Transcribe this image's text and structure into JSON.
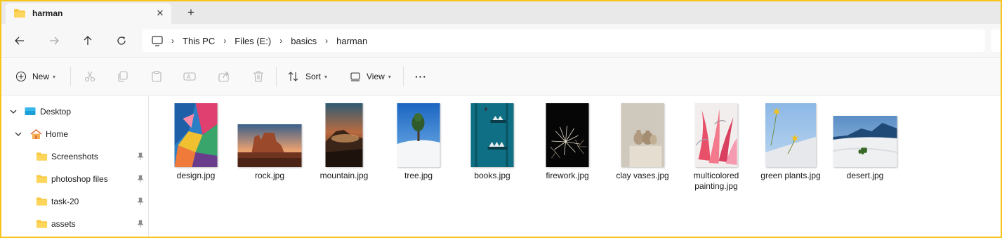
{
  "tab": {
    "title": "harman",
    "close_glyph": "✕",
    "new_tab_glyph": "+"
  },
  "nav": {
    "breadcrumbs": [
      "This PC",
      "Files (E:)",
      "basics",
      "harman"
    ]
  },
  "command_bar": {
    "new_label": "New",
    "sort_label": "Sort",
    "view_label": "View",
    "more_glyph": "···"
  },
  "sidebar": {
    "items": [
      {
        "label": "Desktop",
        "icon": "desktop-icon"
      },
      {
        "label": "Home",
        "icon": "home-icon"
      },
      {
        "label": "Screenshots",
        "icon": "folder-icon",
        "pinned": true
      },
      {
        "label": "photoshop files",
        "icon": "folder-icon",
        "pinned": true
      },
      {
        "label": "task-20",
        "icon": "folder-icon",
        "pinned": true
      },
      {
        "label": "assets",
        "icon": "folder-icon",
        "pinned": true
      }
    ]
  },
  "files": [
    {
      "name": "design.jpg"
    },
    {
      "name": "rock.jpg"
    },
    {
      "name": "mountain.jpg"
    },
    {
      "name": "tree.jpg"
    },
    {
      "name": "books.jpg"
    },
    {
      "name": "firework.jpg"
    },
    {
      "name": "clay vases.jpg"
    },
    {
      "name": "multicolored painting.jpg"
    },
    {
      "name": "green plants.jpg"
    },
    {
      "name": "desert.jpg"
    }
  ],
  "colors": {
    "accent": "#f5c518",
    "folder": "#f8c942",
    "window_bg": "#f7f7f7"
  }
}
